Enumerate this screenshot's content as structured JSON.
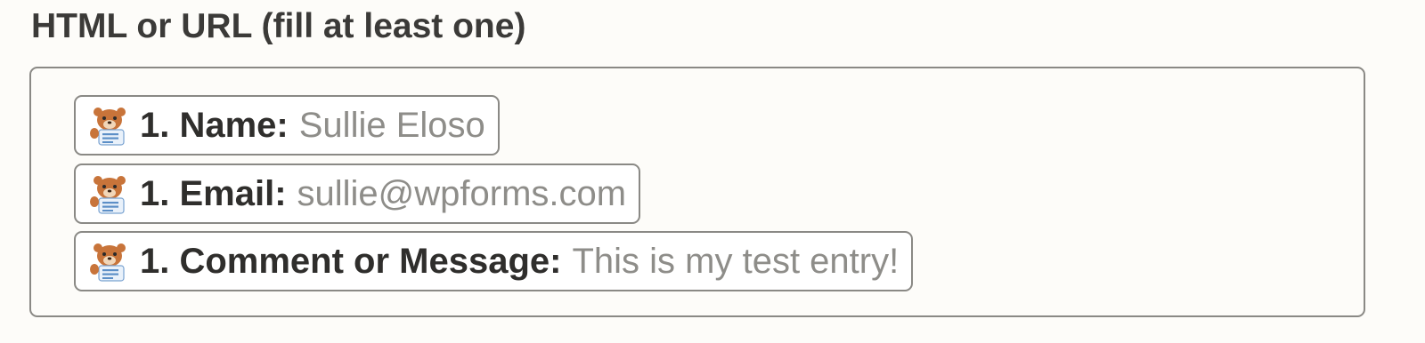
{
  "field": {
    "label": "HTML or URL (fill at least one)"
  },
  "pills": [
    {
      "icon": "wpforms-bear-icon",
      "field": "1. Name:",
      "value": "Sullie Eloso"
    },
    {
      "icon": "wpforms-bear-icon",
      "field": "1. Email:",
      "value": "sullie@wpforms.com"
    },
    {
      "icon": "wpforms-bear-icon",
      "field": "1. Comment or Message:",
      "value": "This is my test entry!"
    }
  ],
  "colors": {
    "background": "#fdfcf9",
    "border": "#8a8985",
    "label_text": "#3b3a38",
    "pill_field_text": "#2f2e2c",
    "pill_value_text": "#8e8d89",
    "bear_fur": "#c8743a"
  }
}
